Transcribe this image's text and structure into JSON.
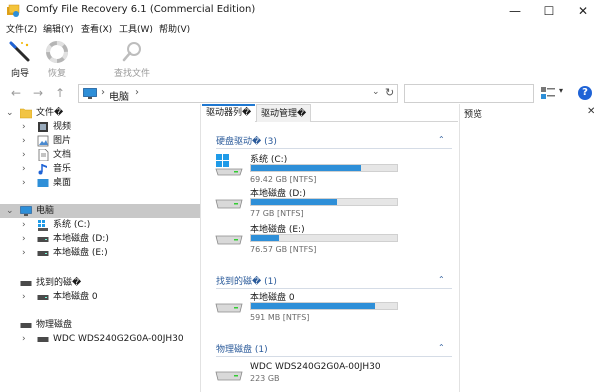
{
  "window": {
    "title": "Comfy File Recovery 6.1 (Commercial Edition)",
    "minimize": "—",
    "maximize": "☐",
    "close": "✕"
  },
  "menu": [
    "文件(Z)",
    "编辑(Y)",
    "查看(X)",
    "工具(W)",
    "帮助(V)"
  ],
  "toolbar": {
    "wizard_label": "向导",
    "restore_label": "恢复",
    "find_label": "查找文件"
  },
  "address": {
    "back": "←",
    "forward": "→",
    "up": "↑",
    "separator": "›",
    "crumb": "电脑",
    "dropdown": "⌄",
    "refresh": "↻",
    "view_dropdown": "▾",
    "help": "?"
  },
  "tree": {
    "expanded_chevron": "⌄",
    "collapsed_chevron": "›",
    "folders_label": "文件�",
    "folder_items": [
      "视频",
      "图片",
      "文档",
      "音乐",
      "桌面"
    ],
    "computer_label": "电脑",
    "computer_items": [
      "系统 (C:)",
      "本地磁盘 (D:)",
      "本地磁盘 (E:)"
    ],
    "found_label": "找到的磁�",
    "found_items": [
      "本地磁盘 0"
    ],
    "physical_label": "物理磁盘",
    "physical_items": [
      "WDC WDS240G2G0A-00JH30"
    ]
  },
  "tabs": {
    "drive_list": "驱动器列�",
    "drive_manager": "驱动管理�"
  },
  "groups": {
    "chevron": "⌃",
    "hard_disks": {
      "title": "硬盘驱动�",
      "count": "(3)"
    },
    "found_disks": {
      "title": "找到的磁�",
      "count": "(1)"
    },
    "physical_disks": {
      "title": "物理磁盘",
      "count": "(1)"
    }
  },
  "drives": [
    {
      "name": "系统 (C:)",
      "info": "69.42 GB [NTFS]",
      "used": 0.75,
      "windows": true
    },
    {
      "name": "本地磁盘 (D:)",
      "info": "77 GB [NTFS]",
      "used": 0.59,
      "windows": false
    },
    {
      "name": "本地磁盘 (E:)",
      "info": "76.57 GB [NTFS]",
      "used": 0.19,
      "windows": false
    }
  ],
  "found_drives": [
    {
      "name": "本地磁盘 0",
      "info": "591 MB [NTFS]",
      "used": 0.85
    }
  ],
  "physical_drives": [
    {
      "name": "WDC WDS240G2G0A-00JH30",
      "info": "223 GB"
    }
  ],
  "preview": {
    "title": "预览",
    "close": "✕"
  },
  "colors": {
    "accent": "#1f78d1",
    "bar_fill": "#2e8fd8",
    "selection": "#c8c8c8",
    "group_text": "#2a5a9a"
  }
}
